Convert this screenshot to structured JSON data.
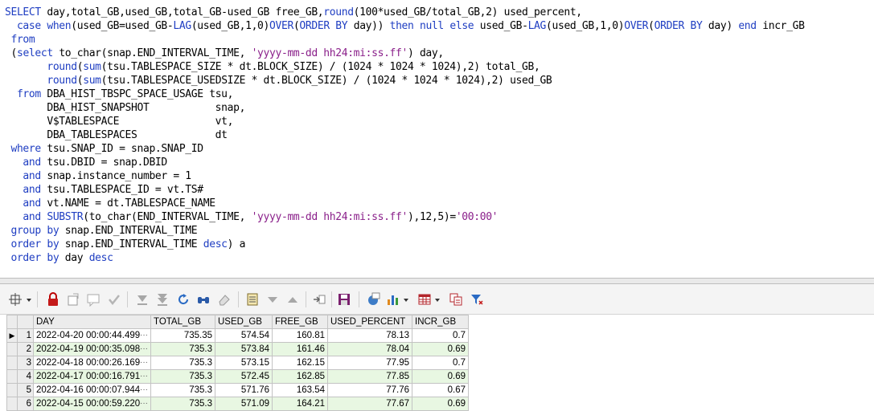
{
  "sql_lines": [
    [
      {
        "t": "SELECT ",
        "c": "kw"
      },
      {
        "t": "day,total_GB,used_GB,total_GB-used_GB free_GB,"
      },
      {
        "t": "round",
        "c": "kw"
      },
      {
        "t": "(100*used_GB/total_GB,2) used_percent,"
      }
    ],
    [
      {
        "t": "  case ",
        "c": "kw"
      },
      {
        "t": "when",
        "c": "kw"
      },
      {
        "t": "(used_GB=used_GB-"
      },
      {
        "t": "LAG",
        "c": "kw"
      },
      {
        "t": "(used_GB,1,0)"
      },
      {
        "t": "OVER",
        "c": "kw"
      },
      {
        "t": "("
      },
      {
        "t": "ORDER BY ",
        "c": "kw"
      },
      {
        "t": "day)) "
      },
      {
        "t": "then null else ",
        "c": "kw"
      },
      {
        "t": "used_GB-"
      },
      {
        "t": "LAG",
        "c": "kw"
      },
      {
        "t": "(used_GB,1,0)"
      },
      {
        "t": "OVER",
        "c": "kw"
      },
      {
        "t": "("
      },
      {
        "t": "ORDER BY ",
        "c": "kw"
      },
      {
        "t": "day) "
      },
      {
        "t": "end ",
        "c": "kw"
      },
      {
        "t": "incr_GB"
      }
    ],
    [
      {
        "t": " from",
        "c": "kw"
      }
    ],
    [
      {
        "t": " ("
      },
      {
        "t": "select ",
        "c": "kw"
      },
      {
        "t": "to_char(snap.END_INTERVAL_TIME, "
      },
      {
        "t": "'yyyy-mm-dd hh24:mi:ss.ff'",
        "c": "str"
      },
      {
        "t": ") day,"
      }
    ],
    [
      {
        "t": "       "
      },
      {
        "t": "round",
        "c": "kw"
      },
      {
        "t": "("
      },
      {
        "t": "sum",
        "c": "kw"
      },
      {
        "t": "(tsu.TABLESPACE_SIZE * dt.BLOCK_SIZE) / (1024 * 1024 * 1024),2) total_GB,"
      }
    ],
    [
      {
        "t": "       "
      },
      {
        "t": "round",
        "c": "kw"
      },
      {
        "t": "("
      },
      {
        "t": "sum",
        "c": "kw"
      },
      {
        "t": "(tsu.TABLESPACE_USEDSIZE * dt.BLOCK_SIZE) / (1024 * 1024 * 1024),2) used_GB"
      }
    ],
    [
      {
        "t": "  from ",
        "c": "kw"
      },
      {
        "t": "DBA_HIST_TBSPC_SPACE_USAGE tsu,"
      }
    ],
    [
      {
        "t": "       DBA_HIST_SNAPSHOT           snap,"
      }
    ],
    [
      {
        "t": "       V$TABLESPACE                vt,"
      }
    ],
    [
      {
        "t": "       DBA_TABLESPACES             dt"
      }
    ],
    [
      {
        "t": " where ",
        "c": "kw"
      },
      {
        "t": "tsu.SNAP_ID = snap.SNAP_ID"
      }
    ],
    [
      {
        "t": "   and ",
        "c": "kw"
      },
      {
        "t": "tsu.DBID = snap.DBID"
      }
    ],
    [
      {
        "t": "   and ",
        "c": "kw"
      },
      {
        "t": "snap.instance_number = 1"
      }
    ],
    [
      {
        "t": "   and ",
        "c": "kw"
      },
      {
        "t": "tsu.TABLESPACE_ID = vt.TS#"
      }
    ],
    [
      {
        "t": "   and ",
        "c": "kw"
      },
      {
        "t": "vt.NAME = dt.TABLESPACE_NAME"
      }
    ],
    [
      {
        "t": "   and ",
        "c": "kw"
      },
      {
        "t": "SUBSTR",
        "c": "kw"
      },
      {
        "t": "(to_char(END_INTERVAL_TIME, "
      },
      {
        "t": "'yyyy-mm-dd hh24:mi:ss.ff'",
        "c": "str"
      },
      {
        "t": "),12,5)="
      },
      {
        "t": "'00:00'",
        "c": "str"
      }
    ],
    [
      {
        "t": " group by ",
        "c": "kw"
      },
      {
        "t": "snap.END_INTERVAL_TIME"
      }
    ],
    [
      {
        "t": " order by ",
        "c": "kw"
      },
      {
        "t": "snap.END_INTERVAL_TIME "
      },
      {
        "t": "desc",
        "c": "kw"
      },
      {
        "t": ") a"
      }
    ],
    [
      {
        "t": " order by ",
        "c": "kw"
      },
      {
        "t": "day "
      },
      {
        "t": "desc",
        "c": "kw"
      }
    ]
  ],
  "toolbar": {
    "icons": [
      "pin-icon",
      "lock-icon",
      "clear-icon",
      "comment-icon",
      "commit-icon",
      "next-record-icon",
      "last-record-icon",
      "refresh-icon",
      "find-icon",
      "eraser-icon",
      "grid-view-icon",
      "filter-down-icon",
      "filter-up-icon",
      "export-icon",
      "save-icon",
      "query-by-example-icon",
      "chart-icon",
      "table-icon",
      "copy-icon",
      "filter-icon"
    ]
  },
  "grid": {
    "columns": [
      "DAY",
      "TOTAL_GB",
      "USED_GB",
      "FREE_GB",
      "USED_PERCENT",
      "INCR_GB"
    ],
    "rows": [
      {
        "n": "1",
        "day": "2022-04-20 00:00:44.499",
        "total": "735.35",
        "used": "574.54",
        "free": "160.81",
        "pct": "78.13",
        "incr": "0.7"
      },
      {
        "n": "2",
        "day": "2022-04-19 00:00:35.098",
        "total": "735.3",
        "used": "573.84",
        "free": "161.46",
        "pct": "78.04",
        "incr": "0.69"
      },
      {
        "n": "3",
        "day": "2022-04-18 00:00:26.169",
        "total": "735.3",
        "used": "573.15",
        "free": "162.15",
        "pct": "77.95",
        "incr": "0.7"
      },
      {
        "n": "4",
        "day": "2022-04-17 00:00:16.791",
        "total": "735.3",
        "used": "572.45",
        "free": "162.85",
        "pct": "77.85",
        "incr": "0.69"
      },
      {
        "n": "5",
        "day": "2022-04-16 00:00:07.944",
        "total": "735.3",
        "used": "571.76",
        "free": "163.54",
        "pct": "77.76",
        "incr": "0.67"
      },
      {
        "n": "6",
        "day": "2022-04-15 00:00:59.220",
        "total": "735.3",
        "used": "571.09",
        "free": "164.21",
        "pct": "77.67",
        "incr": "0.69"
      }
    ],
    "ellipsis": "···",
    "current_row_marker": "▶"
  },
  "colors": {
    "keyword": "#1f3ec2",
    "string": "#8a1f8a",
    "alt_row": "#e8f7e2"
  }
}
